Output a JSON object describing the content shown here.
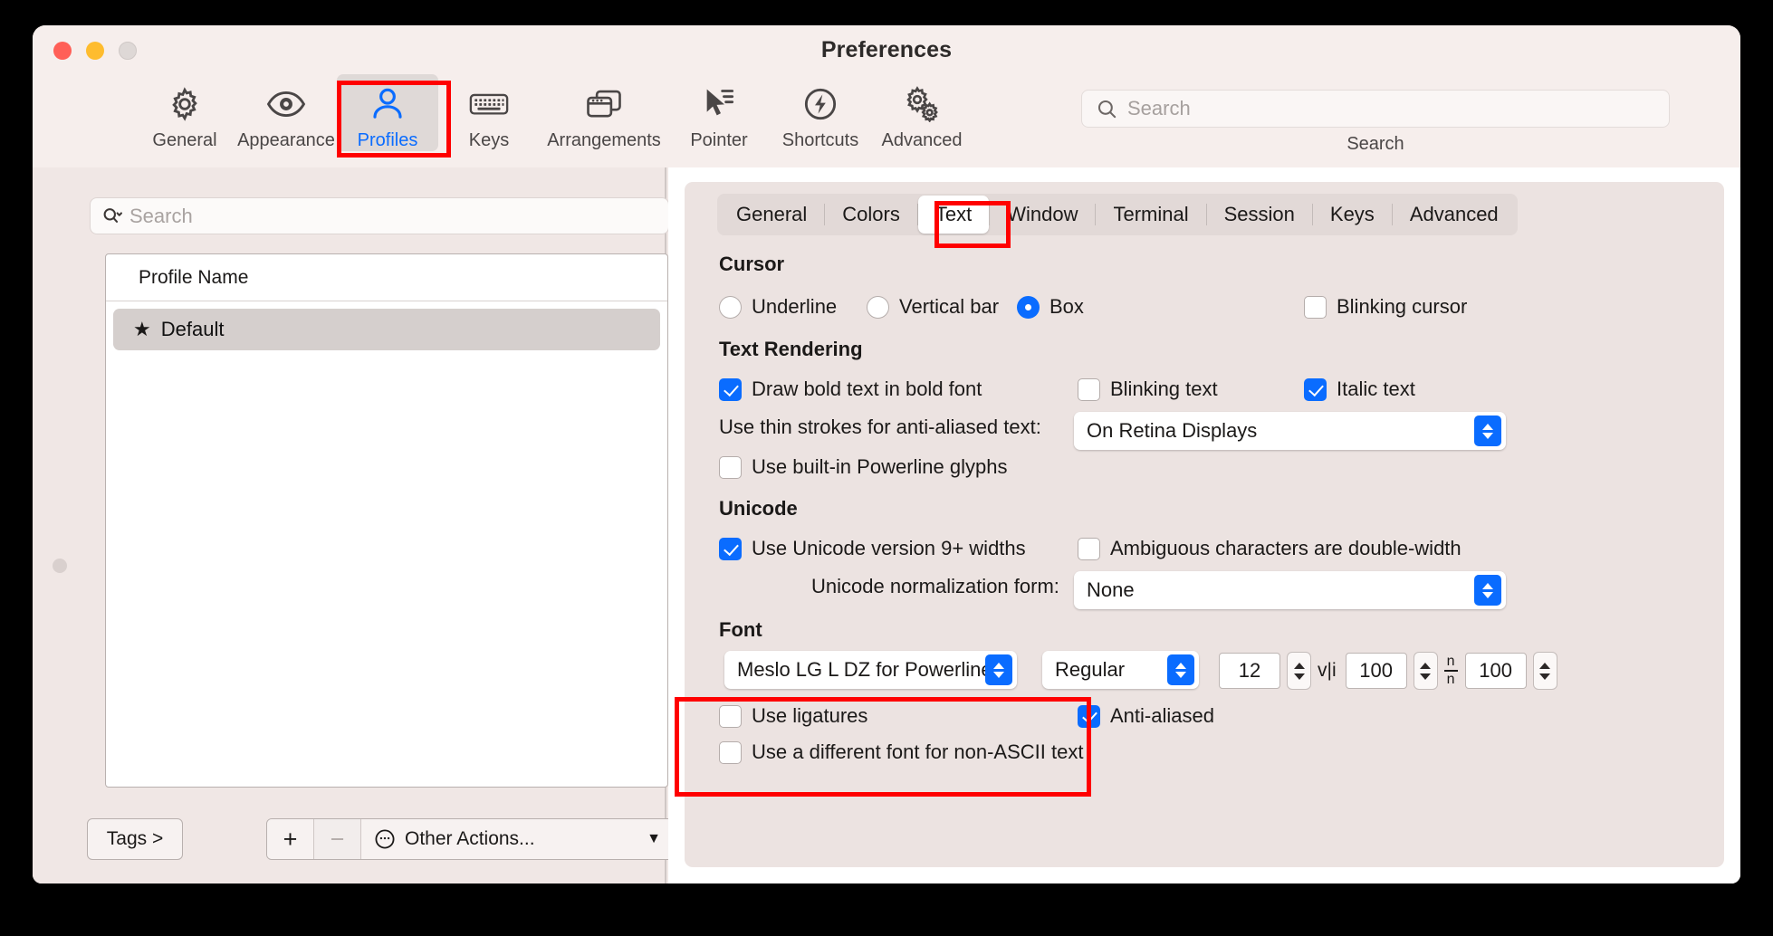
{
  "window": {
    "title": "Preferences",
    "traffic_lights": [
      "close-red",
      "minimize-yellow",
      "zoom-gray"
    ]
  },
  "toolbar": {
    "items": [
      {
        "label": "General",
        "icon": "gear-icon",
        "selected": false
      },
      {
        "label": "Appearance",
        "icon": "eye-icon",
        "selected": false
      },
      {
        "label": "Profiles",
        "icon": "person-icon",
        "selected": true
      },
      {
        "label": "Keys",
        "icon": "keyboard-icon",
        "selected": false
      },
      {
        "label": "Arrangements",
        "icon": "windows-icon",
        "selected": false
      },
      {
        "label": "Pointer",
        "icon": "cursor-icon",
        "selected": false
      },
      {
        "label": "Shortcuts",
        "icon": "bolt-circle-icon",
        "selected": false
      },
      {
        "label": "Advanced",
        "icon": "gears-icon",
        "selected": false
      }
    ],
    "search": {
      "placeholder": "Search",
      "value": "",
      "caption": "Search",
      "icon": "search-icon"
    }
  },
  "sidebar": {
    "search": {
      "placeholder": "Search",
      "value": "",
      "icon": "search-chevron-icon"
    },
    "list": {
      "header": "Profile Name",
      "rows": [
        {
          "name": "Default",
          "starred": true,
          "selected": true
        }
      ]
    },
    "bottom": {
      "tags_label": "Tags >",
      "add_label": "+",
      "remove_label": "−",
      "other_actions_label": "Other Actions...",
      "other_actions_icon": "ellipsis-circle-icon",
      "chevron": "⌄"
    }
  },
  "tabs": [
    {
      "label": "General",
      "active": false
    },
    {
      "label": "Colors",
      "active": false
    },
    {
      "label": "Text",
      "active": true
    },
    {
      "label": "Window",
      "active": false
    },
    {
      "label": "Terminal",
      "active": false
    },
    {
      "label": "Session",
      "active": false
    },
    {
      "label": "Keys",
      "active": false
    },
    {
      "label": "Advanced",
      "active": false
    }
  ],
  "sections": {
    "cursor": {
      "title": "Cursor",
      "options": [
        {
          "label": "Underline",
          "selected": false
        },
        {
          "label": "Vertical bar",
          "selected": false
        },
        {
          "label": "Box",
          "selected": true
        }
      ],
      "blinking": {
        "label": "Blinking cursor",
        "checked": false
      }
    },
    "text_rendering": {
      "title": "Text Rendering",
      "bold": {
        "label": "Draw bold text in bold font",
        "checked": true
      },
      "blinking": {
        "label": "Blinking text",
        "checked": false
      },
      "italic": {
        "label": "Italic text",
        "checked": true
      },
      "thin_strokes": {
        "label": "Use thin strokes for anti-aliased text:",
        "value": "On Retina Displays"
      },
      "powerline": {
        "label": "Use built-in Powerline glyphs",
        "checked": false
      }
    },
    "unicode": {
      "title": "Unicode",
      "v9": {
        "label": "Use Unicode version 9+ widths",
        "checked": true
      },
      "ambiguous": {
        "label": "Ambiguous characters are double-width",
        "checked": false
      },
      "normalization": {
        "label": "Unicode normalization form:",
        "value": "None"
      }
    },
    "font": {
      "title": "Font",
      "family": "Meslo LG L DZ for Powerline",
      "weight": "Regular",
      "size": "12",
      "horizontal_spacing": "100",
      "horizontal_glyph": "v|i",
      "vertical_spacing": "100",
      "vertical_glyph": "n/n",
      "ligatures": {
        "label": "Use ligatures",
        "checked": false
      },
      "antialiased": {
        "label": "Anti-aliased",
        "checked": true
      },
      "non_ascii": {
        "label": "Use a different font for non-ASCII text",
        "checked": false
      }
    }
  },
  "annotations": {
    "highlight_color": "#ff0000",
    "boxes": [
      "profiles-toolbar-item",
      "text-tab",
      "font-section"
    ]
  },
  "colors": {
    "accent": "#0a6cff",
    "window_bg": "#f4ebe9",
    "pane_bg": "#ece3e1",
    "highlight": "#ff0000"
  }
}
